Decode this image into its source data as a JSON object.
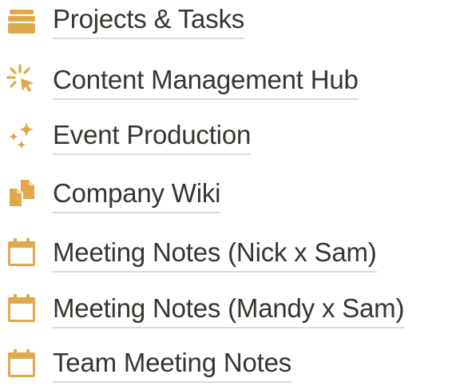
{
  "colors": {
    "icon": "#e0a84a",
    "text": "#37352f",
    "underline": "#dcdbd8"
  },
  "pages": [
    {
      "icon": "stack-icon",
      "label": "Projects & Tasks"
    },
    {
      "icon": "sparkle-cursor-icon",
      "label": "Content Management Hub"
    },
    {
      "icon": "sparkles-icon",
      "label": "Event Production"
    },
    {
      "icon": "copy-documents-icon",
      "label": "Company Wiki"
    },
    {
      "icon": "calendar-icon",
      "label": "Meeting Notes (Nick x Sam)"
    },
    {
      "icon": "calendar-icon",
      "label": "Meeting Notes (Mandy x Sam)"
    },
    {
      "icon": "calendar-icon",
      "label": "Team Meeting Notes"
    }
  ]
}
